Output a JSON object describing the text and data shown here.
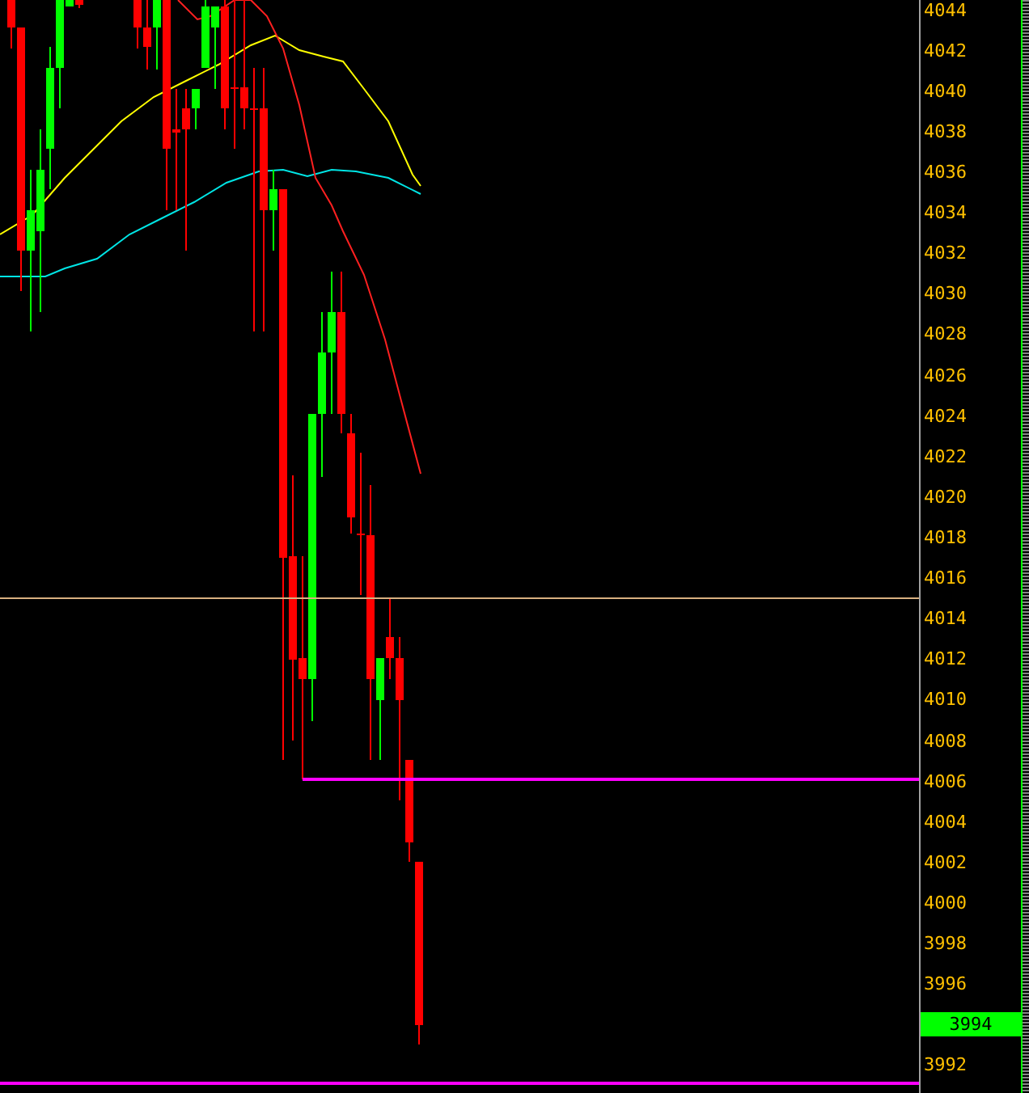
{
  "price_axis": {
    "ticks": [
      {
        "label": "4044",
        "kind": "tick"
      },
      {
        "label": "4042",
        "kind": "tick"
      },
      {
        "label": "4040",
        "kind": "tick"
      },
      {
        "label": "4038",
        "kind": "tick"
      },
      {
        "label": "4036",
        "kind": "tick"
      },
      {
        "label": "4034",
        "kind": "tick"
      },
      {
        "label": "4032",
        "kind": "tick"
      },
      {
        "label": "4030",
        "kind": "tick"
      },
      {
        "label": "4028",
        "kind": "tick"
      },
      {
        "label": "4026",
        "kind": "tick"
      },
      {
        "label": "4024",
        "kind": "tick"
      },
      {
        "label": "4022",
        "kind": "tick"
      },
      {
        "label": "4020",
        "kind": "tick"
      },
      {
        "label": "4018",
        "kind": "tick"
      },
      {
        "label": "4016",
        "kind": "tick"
      },
      {
        "label": "4014",
        "kind": "tick"
      },
      {
        "label": "4012",
        "kind": "tick"
      },
      {
        "label": "4010",
        "kind": "tick"
      },
      {
        "label": "4008",
        "kind": "tick"
      },
      {
        "label": "4006",
        "kind": "tick"
      },
      {
        "label": "4004",
        "kind": "tick"
      },
      {
        "label": "4002",
        "kind": "tick"
      },
      {
        "label": "4000",
        "kind": "tick"
      },
      {
        "label": "3998",
        "kind": "tick"
      },
      {
        "label": "3996",
        "kind": "tick"
      },
      {
        "label": "3994",
        "kind": "current"
      },
      {
        "label": "3992",
        "kind": "tick"
      }
    ]
  }
}
